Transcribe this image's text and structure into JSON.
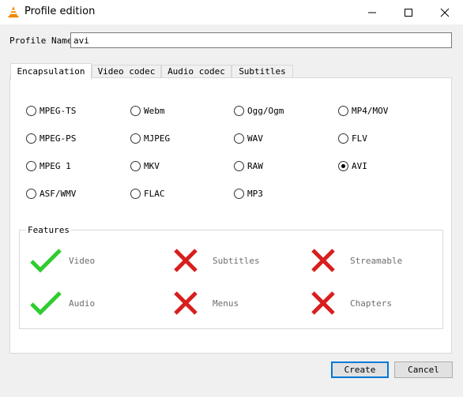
{
  "window": {
    "title": "Profile edition"
  },
  "profile": {
    "label": "Profile Name",
    "value": "avi"
  },
  "tabs": [
    {
      "label": "Encapsulation",
      "active": true
    },
    {
      "label": "Video codec",
      "active": false
    },
    {
      "label": "Audio codec",
      "active": false
    },
    {
      "label": "Subtitles",
      "active": false
    }
  ],
  "formats": [
    {
      "label": "MPEG-TS",
      "checked": false
    },
    {
      "label": "Webm",
      "checked": false
    },
    {
      "label": "Ogg/Ogm",
      "checked": false
    },
    {
      "label": "MP4/MOV",
      "checked": false
    },
    {
      "label": "MPEG-PS",
      "checked": false
    },
    {
      "label": "MJPEG",
      "checked": false
    },
    {
      "label": "WAV",
      "checked": false
    },
    {
      "label": "FLV",
      "checked": false
    },
    {
      "label": "MPEG 1",
      "checked": false
    },
    {
      "label": "MKV",
      "checked": false
    },
    {
      "label": "RAW",
      "checked": false
    },
    {
      "label": "AVI",
      "checked": true
    },
    {
      "label": "ASF/WMV",
      "checked": false
    },
    {
      "label": "FLAC",
      "checked": false
    },
    {
      "label": "MP3",
      "checked": false
    }
  ],
  "features": {
    "title": "Features",
    "items": [
      {
        "label": "Video",
        "supported": true,
        "icon": "check-icon"
      },
      {
        "label": "Subtitles",
        "supported": false,
        "icon": "cross-icon"
      },
      {
        "label": "Streamable",
        "supported": false,
        "icon": "cross-icon"
      },
      {
        "label": "Audio",
        "supported": true,
        "icon": "check-icon"
      },
      {
        "label": "Menus",
        "supported": false,
        "icon": "cross-icon"
      },
      {
        "label": "Chapters",
        "supported": false,
        "icon": "cross-icon"
      }
    ]
  },
  "buttons": {
    "create": "Create",
    "cancel": "Cancel"
  },
  "colors": {
    "check": "#2ecc2e",
    "cross": "#d81e1e",
    "focus": "#0078d7"
  }
}
